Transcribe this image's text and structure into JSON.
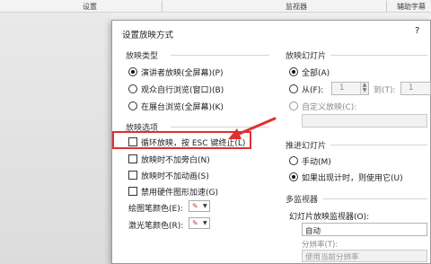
{
  "ribbon": {
    "settings": "设置",
    "monitor": "监视器",
    "aux": "辅助字幕"
  },
  "dialog": {
    "title": "设置放映方式",
    "help": "?",
    "show_type": {
      "heading": "放映类型",
      "options": [
        "演讲者放映(全屏幕)(P)",
        "观众自行浏览(窗口)(B)",
        "在展台浏览(全屏幕)(K)"
      ],
      "selected_index": 0
    },
    "show_options": {
      "heading": "放映选项",
      "items": [
        {
          "label": "循环放映，按 ESC 键终止(L)",
          "checked": false
        },
        {
          "label": "放映时不加旁白(N)",
          "checked": false
        },
        {
          "label": "放映时不加动画(S)",
          "checked": false
        },
        {
          "label": "禁用硬件图形加速(G)",
          "checked": false
        }
      ],
      "pen_color": "绘图笔颜色(E):",
      "laser_color": "激光笔颜色(R):"
    },
    "slides": {
      "heading": "放映幻灯片",
      "all": "全部(A)",
      "from": "从(F):",
      "from_value": "1",
      "to": "到(T):",
      "to_value": "1",
      "custom": "自定义放映(C):"
    },
    "advance": {
      "heading": "推进幻灯片",
      "manual": "手动(M)",
      "timing": "如果出现计时，则使用它(U)"
    },
    "monitors": {
      "heading": "多监视器",
      "monitor_label": "幻灯片放映监视器(O):",
      "monitor_value": "自动",
      "resolution_label": "分辨率(T):",
      "resolution_value": "使用当前分辨率"
    }
  },
  "colors": {
    "red_highlight": "#e03030",
    "pen": "#c0392b"
  }
}
